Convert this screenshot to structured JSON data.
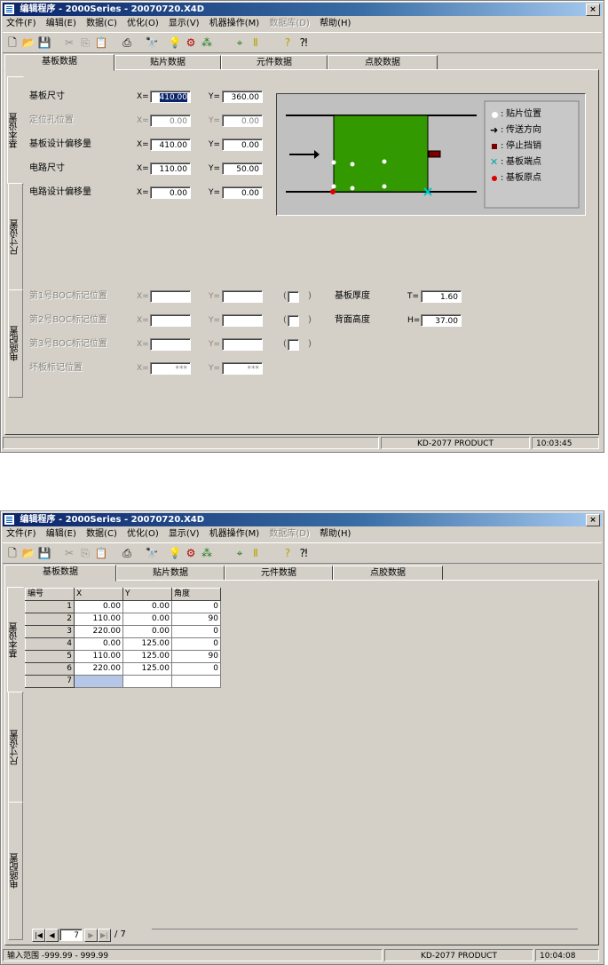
{
  "window": {
    "title": "编辑程序 - 2000Series - 20070720.X4D",
    "close": "×"
  },
  "menu": [
    "文件(F)",
    "编辑(E)",
    "数据(C)",
    "优化(O)",
    "显示(V)",
    "机器操作(M)",
    "数据库(D)",
    "帮助(H)"
  ],
  "tabs": [
    "基板数据",
    "贴片数据",
    "元件数据",
    "点胶数据"
  ],
  "side_tabs": [
    "基本设置",
    "尺寸设置",
    "电路配置"
  ],
  "screen1": {
    "rows": [
      {
        "label": "基板尺寸",
        "x": "410.00",
        "y": "360.00"
      },
      {
        "label": "定位孔位置",
        "x": "0.00",
        "y": "0.00"
      },
      {
        "label": "基板设计偏移量",
        "x": "410.00",
        "y": "0.00"
      },
      {
        "label": "电路尺寸",
        "x": "110.00",
        "y": "50.00"
      },
      {
        "label": "电路设计偏移量",
        "x": "0.00",
        "y": "0.00"
      }
    ],
    "bad_marks": [
      {
        "label": "第1号BOC标记位置"
      },
      {
        "label": "第2号BOC标记位置"
      },
      {
        "label": "第3号BOC标记位置"
      },
      {
        "label": "坏板标记位置",
        "x": "***",
        "y": "***"
      }
    ],
    "thickness": {
      "label": "基板厚度",
      "prefix": "T=",
      "value": "1.60"
    },
    "back_height": {
      "label": "背面高度",
      "prefix": "H=",
      "value": "37.00"
    },
    "prefix_x": "X=",
    "prefix_y": "Y=",
    "paren_open": "(",
    "paren_close": ")",
    "legend": [
      {
        "icon": "white-dot",
        "text": "贴片位置"
      },
      {
        "icon": "arrow",
        "text": "传送方向"
      },
      {
        "icon": "dark-red-square",
        "text": "停止挡销"
      },
      {
        "icon": "cyan-x",
        "text": "基板端点"
      },
      {
        "icon": "red-dot",
        "text": "基板原点"
      }
    ],
    "legend_colon": ":",
    "status": {
      "left": "",
      "product": "KD-2077 PRODUCT",
      "time": "10:03:45"
    }
  },
  "screen2": {
    "headers": [
      "编号",
      "X",
      "Y",
      "角度"
    ],
    "rows": [
      {
        "n": "1",
        "x": "0.00",
        "y": "0.00",
        "a": "0"
      },
      {
        "n": "2",
        "x": "110.00",
        "y": "0.00",
        "a": "90"
      },
      {
        "n": "3",
        "x": "220.00",
        "y": "0.00",
        "a": "0"
      },
      {
        "n": "4",
        "x": "0.00",
        "y": "125.00",
        "a": "0"
      },
      {
        "n": "5",
        "x": "110.00",
        "y": "125.00",
        "a": "90"
      },
      {
        "n": "6",
        "x": "220.00",
        "y": "125.00",
        "a": "0"
      },
      {
        "n": "7",
        "x": "",
        "y": "",
        "a": ""
      }
    ],
    "nav": {
      "current": "7",
      "total": "/ 7"
    },
    "status": {
      "left": "输入范围  -999.99 - 999.99",
      "product": "KD-2077 PRODUCT",
      "time": "10:04:08"
    }
  },
  "colors": {
    "board": "#339900",
    "title_start": "#0a246a",
    "title_end": "#a6caf0",
    "face": "#d4d0c8"
  }
}
